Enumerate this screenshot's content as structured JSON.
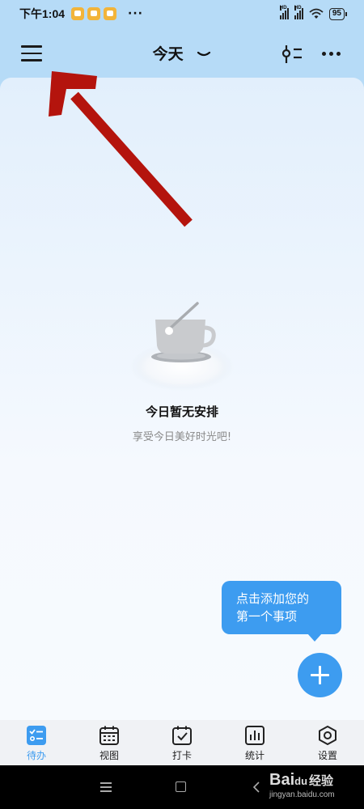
{
  "status_bar": {
    "time": "下午1:04",
    "more_dots": "···",
    "battery": "95",
    "network_labels": [
      "HD",
      "HD"
    ]
  },
  "header": {
    "title": "今天",
    "icons": [
      "menu-icon",
      "chevron-down-icon",
      "filter-icon",
      "more-icon"
    ]
  },
  "empty_state": {
    "title": "今日暂无安排",
    "subtitle": "享受今日美好时光吧!",
    "illustration": "coffee-cup"
  },
  "tooltip": {
    "line1": "点击添加您的",
    "line2": "第一个事项"
  },
  "fab": {
    "icon": "plus-icon"
  },
  "tabs": [
    {
      "label": "待办",
      "icon": "todo-icon",
      "active": true
    },
    {
      "label": "视图",
      "icon": "calendar-icon",
      "active": false
    },
    {
      "label": "打卡",
      "icon": "checkin-icon",
      "active": false
    },
    {
      "label": "统计",
      "icon": "stats-icon",
      "active": false
    },
    {
      "label": "设置",
      "icon": "settings-icon",
      "active": false
    }
  ],
  "watermark": {
    "logo": "Bai",
    "paw": "du",
    "brand": "经验",
    "url": "jingyan.baidu.com"
  },
  "colors": {
    "header_bg": "#b6dbf7",
    "accent": "#3d9cf0",
    "annotation_arrow": "#b4140d"
  }
}
